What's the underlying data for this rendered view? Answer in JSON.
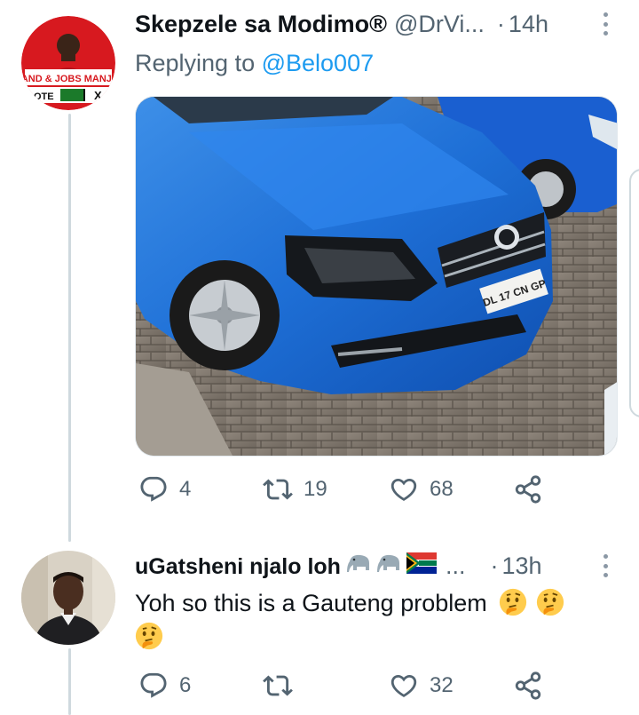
{
  "tweet": {
    "display_name": "Skepzele sa Modimo®",
    "handle": "@DrVi...",
    "separator": "·",
    "time": "14h",
    "replying_prefix": "Replying to",
    "replying_to": "@Belo007",
    "avatar": {
      "banner_text": "LAND & JOBS MANJE!",
      "vote_text": "OTE",
      "mark": "X"
    },
    "media": {
      "plate_text": "DL 17 CN GP"
    },
    "actions": {
      "reply_count": "4",
      "retweet_count": "19",
      "like_count": "68"
    }
  },
  "reply": {
    "display_name": "uGatsheni njalo loh",
    "name_ellipsis": "...",
    "separator": "·",
    "time": "13h",
    "text": "Yoh so this is a Gauteng problem",
    "actions": {
      "reply_count": "6",
      "retweet_count": "",
      "like_count": "32"
    }
  },
  "icons": {
    "reply": "reply-bubble-icon",
    "retweet": "retweet-icon",
    "like": "heart-icon",
    "share": "share-icon",
    "more": "more-dots-icon",
    "thinking": "thinking-face-emoji"
  },
  "colors": {
    "accent": "#1d9bf0",
    "muted": "#536471",
    "text": "#0f1419",
    "thread_line": "#cfd9de"
  }
}
